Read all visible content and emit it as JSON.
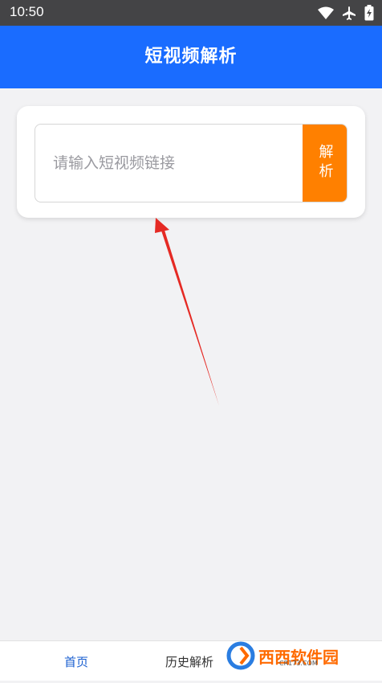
{
  "status_bar": {
    "time": "10:50",
    "icons": [
      "wifi-icon",
      "airplane-icon",
      "battery-charging-icon"
    ]
  },
  "app_bar": {
    "title": "短视频解析",
    "color": "#1a6cff"
  },
  "parser_card": {
    "input_placeholder": "请输入短视频链接",
    "input_value": "",
    "parse_button_label": "解析",
    "parse_button_color": "#ff8000"
  },
  "bottom_nav": {
    "items": [
      {
        "label": "首页",
        "active": true
      },
      {
        "label": "历史解析",
        "active": false
      }
    ],
    "active_color": "#1a5fd0"
  },
  "watermark": {
    "logo_text": "西西软件园",
    "url_text": "CR173.COM"
  }
}
